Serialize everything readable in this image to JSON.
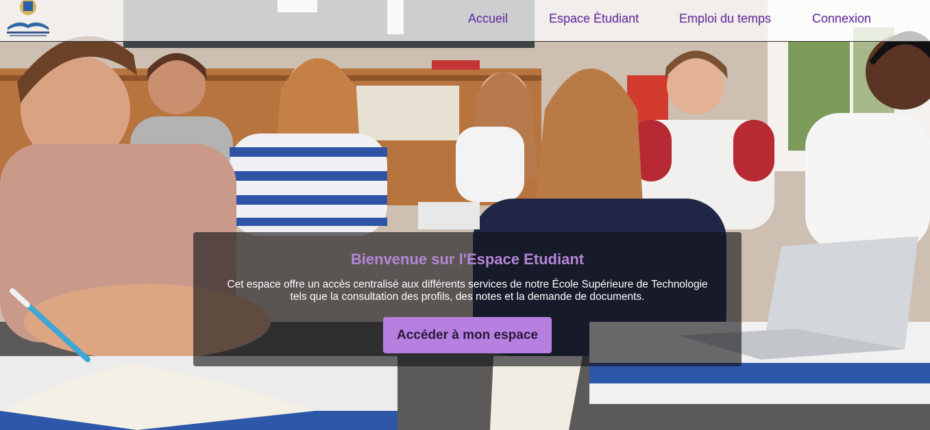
{
  "header": {
    "logo_name": "school-logo",
    "nav": [
      {
        "label": "Accueil"
      },
      {
        "label": "Espace Ètudiant"
      },
      {
        "label": "Emploi du temps"
      },
      {
        "label": "Connexion"
      }
    ]
  },
  "hero": {
    "title": "Bienvenue sur l'Espace Etudiant",
    "line1": "Cet espace offre un accès centralisé aux différents services de notre École Supérieure de Technologie",
    "line2": "tels que la consultation des profils, des notes et la demande de documents.",
    "button_label": "Accéder à mon espace"
  },
  "colors": {
    "accent": "#b67fe0",
    "nav_text": "#6a33a3",
    "title": "#b487d6"
  }
}
